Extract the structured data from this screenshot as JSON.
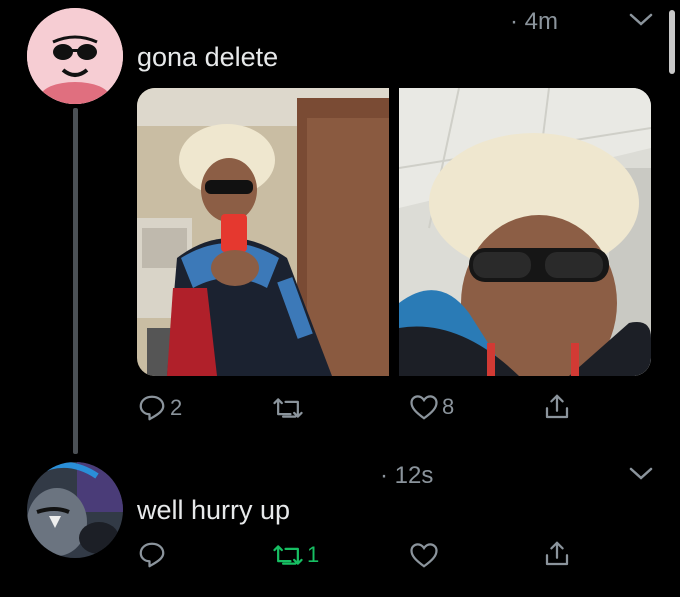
{
  "tweets": [
    {
      "timestamp": "· 4m",
      "text": "gona delete",
      "media_count": 2,
      "actions": {
        "reply_count": "2",
        "retweet_count": "",
        "like_count": "8"
      },
      "icons": {
        "reply": "reply-icon",
        "retweet": "retweet-icon",
        "like": "heart-icon",
        "share": "share-icon",
        "more": "chevron-down-icon"
      }
    },
    {
      "timestamp": "· 12s",
      "text": "well hurry up",
      "actions": {
        "reply_count": "",
        "retweet_count": "1",
        "like_count": ""
      },
      "icons": {
        "reply": "reply-icon",
        "retweet": "retweet-icon",
        "like": "heart-icon",
        "share": "share-icon",
        "more": "chevron-down-icon"
      }
    }
  ],
  "colors": {
    "background": "#000000",
    "text": "#e7e9ea",
    "muted": "#8b949c",
    "retweet_active": "#17bf63",
    "thread_line": "#4b5055"
  }
}
